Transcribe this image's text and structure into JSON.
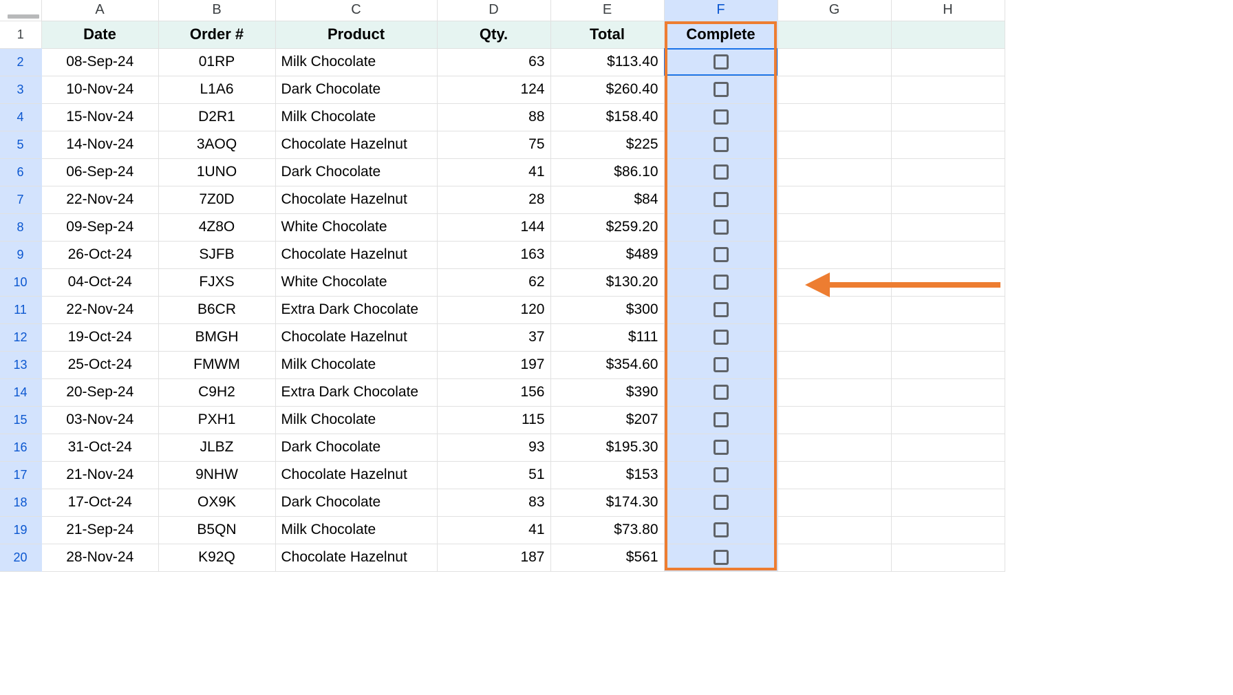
{
  "columns": [
    "A",
    "B",
    "C",
    "D",
    "E",
    "F",
    "G",
    "H"
  ],
  "selected_column": "F",
  "headers": {
    "date": "Date",
    "order": "Order #",
    "product": "Product",
    "qty": "Qty.",
    "total": "Total",
    "complete": "Complete"
  },
  "rows": [
    {
      "n": 2,
      "date": "08-Sep-24",
      "order": "01RP",
      "product": "Milk Chocolate",
      "qty": 63,
      "total": "$113.40"
    },
    {
      "n": 3,
      "date": "10-Nov-24",
      "order": "L1A6",
      "product": "Dark Chocolate",
      "qty": 124,
      "total": "$260.40"
    },
    {
      "n": 4,
      "date": "15-Nov-24",
      "order": "D2R1",
      "product": "Milk Chocolate",
      "qty": 88,
      "total": "$158.40"
    },
    {
      "n": 5,
      "date": "14-Nov-24",
      "order": "3AOQ",
      "product": "Chocolate Hazelnut",
      "qty": 75,
      "total": "$225"
    },
    {
      "n": 6,
      "date": "06-Sep-24",
      "order": "1UNO",
      "product": "Dark Chocolate",
      "qty": 41,
      "total": "$86.10"
    },
    {
      "n": 7,
      "date": "22-Nov-24",
      "order": "7Z0D",
      "product": "Chocolate Hazelnut",
      "qty": 28,
      "total": "$84"
    },
    {
      "n": 8,
      "date": "09-Sep-24",
      "order": "4Z8O",
      "product": "White Chocolate",
      "qty": 144,
      "total": "$259.20"
    },
    {
      "n": 9,
      "date": "26-Oct-24",
      "order": "SJFB",
      "product": "Chocolate Hazelnut",
      "qty": 163,
      "total": "$489"
    },
    {
      "n": 10,
      "date": "04-Oct-24",
      "order": "FJXS",
      "product": "White Chocolate",
      "qty": 62,
      "total": "$130.20"
    },
    {
      "n": 11,
      "date": "22-Nov-24",
      "order": "B6CR",
      "product": "Extra Dark Chocolate",
      "qty": 120,
      "total": "$300"
    },
    {
      "n": 12,
      "date": "19-Oct-24",
      "order": "BMGH",
      "product": "Chocolate Hazelnut",
      "qty": 37,
      "total": "$111"
    },
    {
      "n": 13,
      "date": "25-Oct-24",
      "order": "FMWM",
      "product": "Milk Chocolate",
      "qty": 197,
      "total": "$354.60"
    },
    {
      "n": 14,
      "date": "20-Sep-24",
      "order": "C9H2",
      "product": "Extra Dark Chocolate",
      "qty": 156,
      "total": "$390"
    },
    {
      "n": 15,
      "date": "03-Nov-24",
      "order": "PXH1",
      "product": "Milk Chocolate",
      "qty": 115,
      "total": "$207"
    },
    {
      "n": 16,
      "date": "31-Oct-24",
      "order": "JLBZ",
      "product": "Dark Chocolate",
      "qty": 93,
      "total": "$195.30"
    },
    {
      "n": 17,
      "date": "21-Nov-24",
      "order": "9NHW",
      "product": "Chocolate Hazelnut",
      "qty": 51,
      "total": "$153"
    },
    {
      "n": 18,
      "date": "17-Oct-24",
      "order": "OX9K",
      "product": "Dark Chocolate",
      "qty": 83,
      "total": "$174.30"
    },
    {
      "n": 19,
      "date": "21-Sep-24",
      "order": "B5QN",
      "product": "Milk Chocolate",
      "qty": 41,
      "total": "$73.80"
    },
    {
      "n": 20,
      "date": "28-Nov-24",
      "order": "K92Q",
      "product": "Chocolate Hazelnut",
      "qty": 187,
      "total": "$561"
    }
  ],
  "active_cell": "F2",
  "annotations": {
    "orange_box": {
      "around_column": "F",
      "from_row": 1,
      "to_row": 20
    },
    "arrow_points_to": "column F checkboxes"
  }
}
